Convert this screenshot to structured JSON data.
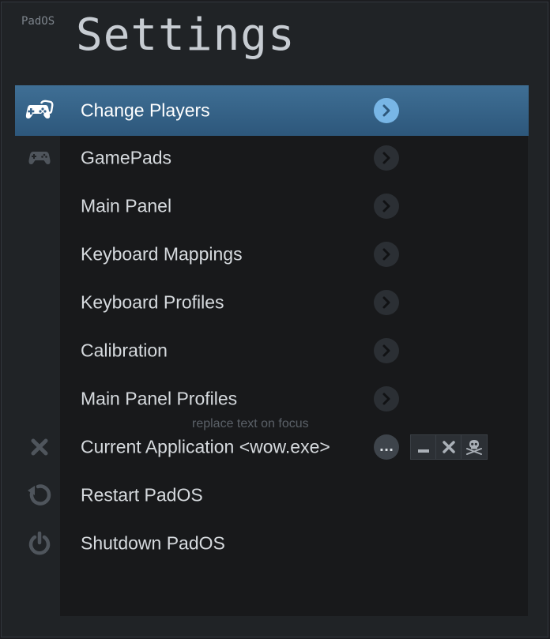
{
  "app": {
    "name": "PadOS",
    "title": "Settings"
  },
  "menu": {
    "items": [
      {
        "label": "Change Players",
        "icon": "gamepad-players-icon",
        "action": "chevron",
        "selected": true
      },
      {
        "label": "GamePads",
        "icon": "gamepad-icon",
        "action": "chevron"
      },
      {
        "label": "Main Panel",
        "icon": "",
        "action": "chevron"
      },
      {
        "label": "Keyboard Mappings",
        "icon": "",
        "action": "chevron"
      },
      {
        "label": "Keyboard Profiles",
        "icon": "",
        "action": "chevron"
      },
      {
        "label": "Calibration",
        "icon": "",
        "action": "chevron"
      },
      {
        "label": "Main Panel Profiles",
        "icon": "",
        "action": "chevron"
      },
      {
        "label": "Current Application <wow.exe>",
        "icon": "close-icon",
        "action": "more",
        "hint": "replace text on focus",
        "window_buttons": [
          "minimize-icon",
          "close-icon",
          "skull-crossbones-icon"
        ]
      },
      {
        "label": "Restart PadOS",
        "icon": "restart-icon",
        "action": "none"
      },
      {
        "label": "Shutdown PadOS",
        "icon": "power-icon",
        "action": "none"
      }
    ],
    "more_label": "..."
  },
  "colors": {
    "background": "#202326",
    "panel": "#18191b",
    "selected": "#35628a",
    "accent": "#78b6e6",
    "text": "#d6dade",
    "muted_icon": "#4f555c"
  }
}
